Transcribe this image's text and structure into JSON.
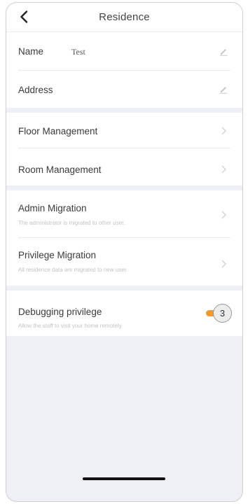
{
  "header": {
    "title": "Residence",
    "back_icon": "chevron-left-icon"
  },
  "info": {
    "name_label": "Name",
    "name_value": "Test",
    "address_label": "Address",
    "edit_icon": "pencil-icon"
  },
  "management": {
    "floor_label": "Floor Management",
    "room_label": "Room Management",
    "chevron_icon": "chevron-right-icon"
  },
  "migration": {
    "admin_label": "Admin Migration",
    "admin_sub": "The administrator is migrated to other user.",
    "privilege_label": "Privilege Migration",
    "privilege_sub": "All residence data are migrated to new user."
  },
  "debugging": {
    "label": "Debugging privilege",
    "sub": "Allow the staff to visit your home remotely.",
    "toggle_on": true,
    "toggle_badge": "3",
    "accent_color": "#f29a2e"
  },
  "colors": {
    "background": "#eef0f5",
    "card": "#ffffff"
  }
}
